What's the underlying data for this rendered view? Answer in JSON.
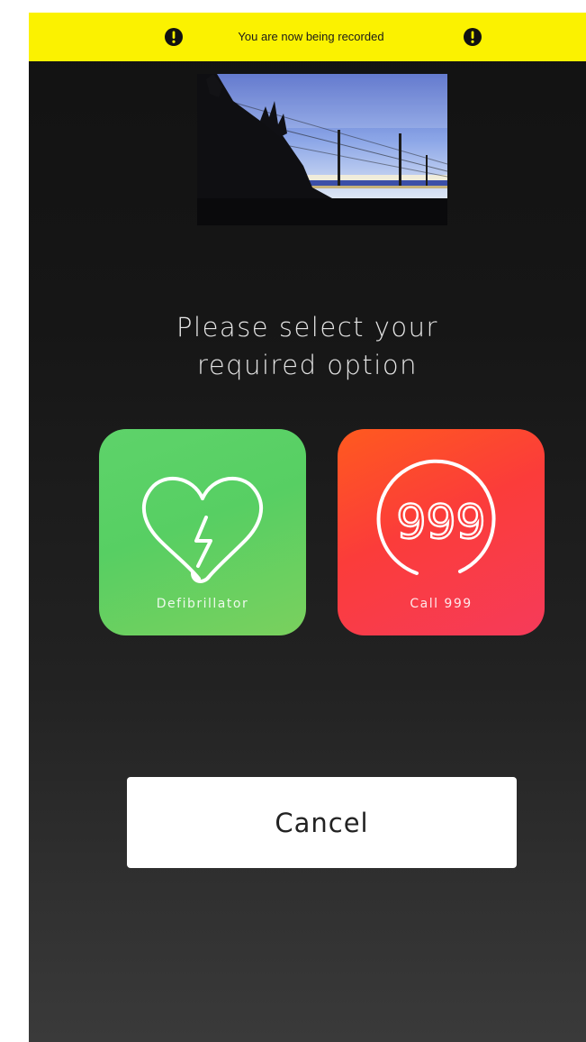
{
  "recording_banner": {
    "text": "You are now being recorded",
    "color": "#fbf200",
    "icon": "exclamation-circle-icon"
  },
  "camera_preview": {
    "icon": "live-camera-feed"
  },
  "prompt": {
    "line1": "Please select your",
    "line2": "required option"
  },
  "options": [
    {
      "label": "Defibrillator",
      "icon": "heart-lightning-icon",
      "color": "#5ed36a"
    },
    {
      "label": "Call 999",
      "icon": "999-circle-icon",
      "glyph_text": "999",
      "color": "#fb3c3a"
    }
  ],
  "cancel": {
    "label": "Cancel"
  }
}
